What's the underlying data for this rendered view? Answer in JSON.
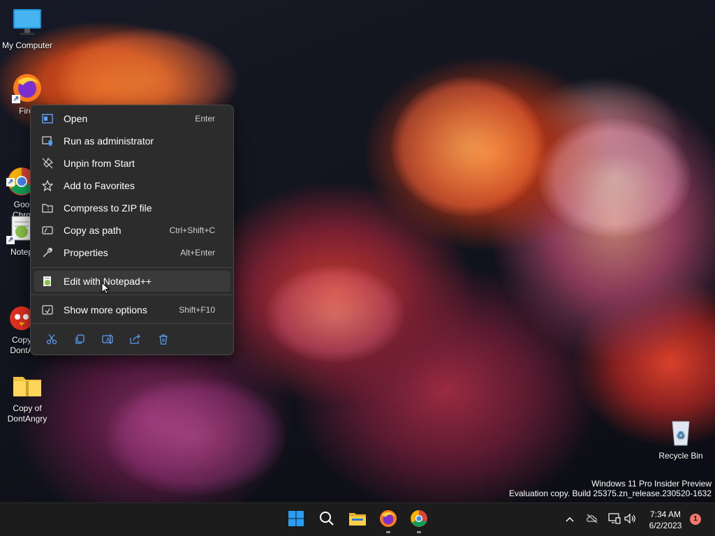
{
  "desktop": {
    "icons": [
      {
        "label": "My Computer"
      },
      {
        "label": "Firef"
      },
      {
        "label": "Goo\nChro"
      },
      {
        "label": "Notep"
      },
      {
        "label": "Copy\nDontA"
      },
      {
        "label": "Copy of\nDontAngry"
      }
    ],
    "recycle_bin": {
      "label": "Recycle Bin"
    }
  },
  "context_menu": {
    "items": [
      {
        "label": "Open",
        "shortcut": "Enter",
        "icon": "open-icon"
      },
      {
        "label": "Run as administrator",
        "shortcut": "",
        "icon": "shield-icon"
      },
      {
        "label": "Unpin from Start",
        "shortcut": "",
        "icon": "unpin-icon"
      },
      {
        "label": "Add to Favorites",
        "shortcut": "",
        "icon": "star-icon"
      },
      {
        "label": "Compress to ZIP file",
        "shortcut": "",
        "icon": "zip-icon"
      },
      {
        "label": "Copy as path",
        "shortcut": "Ctrl+Shift+C",
        "icon": "path-icon"
      },
      {
        "label": "Properties",
        "shortcut": "Alt+Enter",
        "icon": "wrench-icon"
      },
      {
        "label": "Edit with Notepad++",
        "shortcut": "",
        "icon": "notepadpp-icon"
      },
      {
        "label": "Show more options",
        "shortcut": "Shift+F10",
        "icon": "more-options-icon"
      }
    ],
    "toolbar": [
      "cut-icon",
      "copy-icon",
      "rename-icon",
      "share-icon",
      "delete-icon"
    ]
  },
  "watermark": {
    "line1": "Windows 11 Pro Insider Preview",
    "line2": "Evaluation copy. Build 25375.zn_release.230520-1632"
  },
  "taskbar": {
    "apps": [
      "start-icon",
      "search-icon",
      "file-explorer-icon",
      "firefox-icon",
      "chrome-icon"
    ],
    "tray": [
      "chevron-up-icon",
      "network-off-icon",
      "display-icon",
      "volume-icon"
    ],
    "time": "7:34 AM",
    "date": "6/2/2023",
    "notification_count": "1"
  },
  "colors": {
    "menu_bg": "#2c2c2c",
    "taskbar_bg": "#1c1c1c",
    "notification_badge": "#f0786a"
  }
}
